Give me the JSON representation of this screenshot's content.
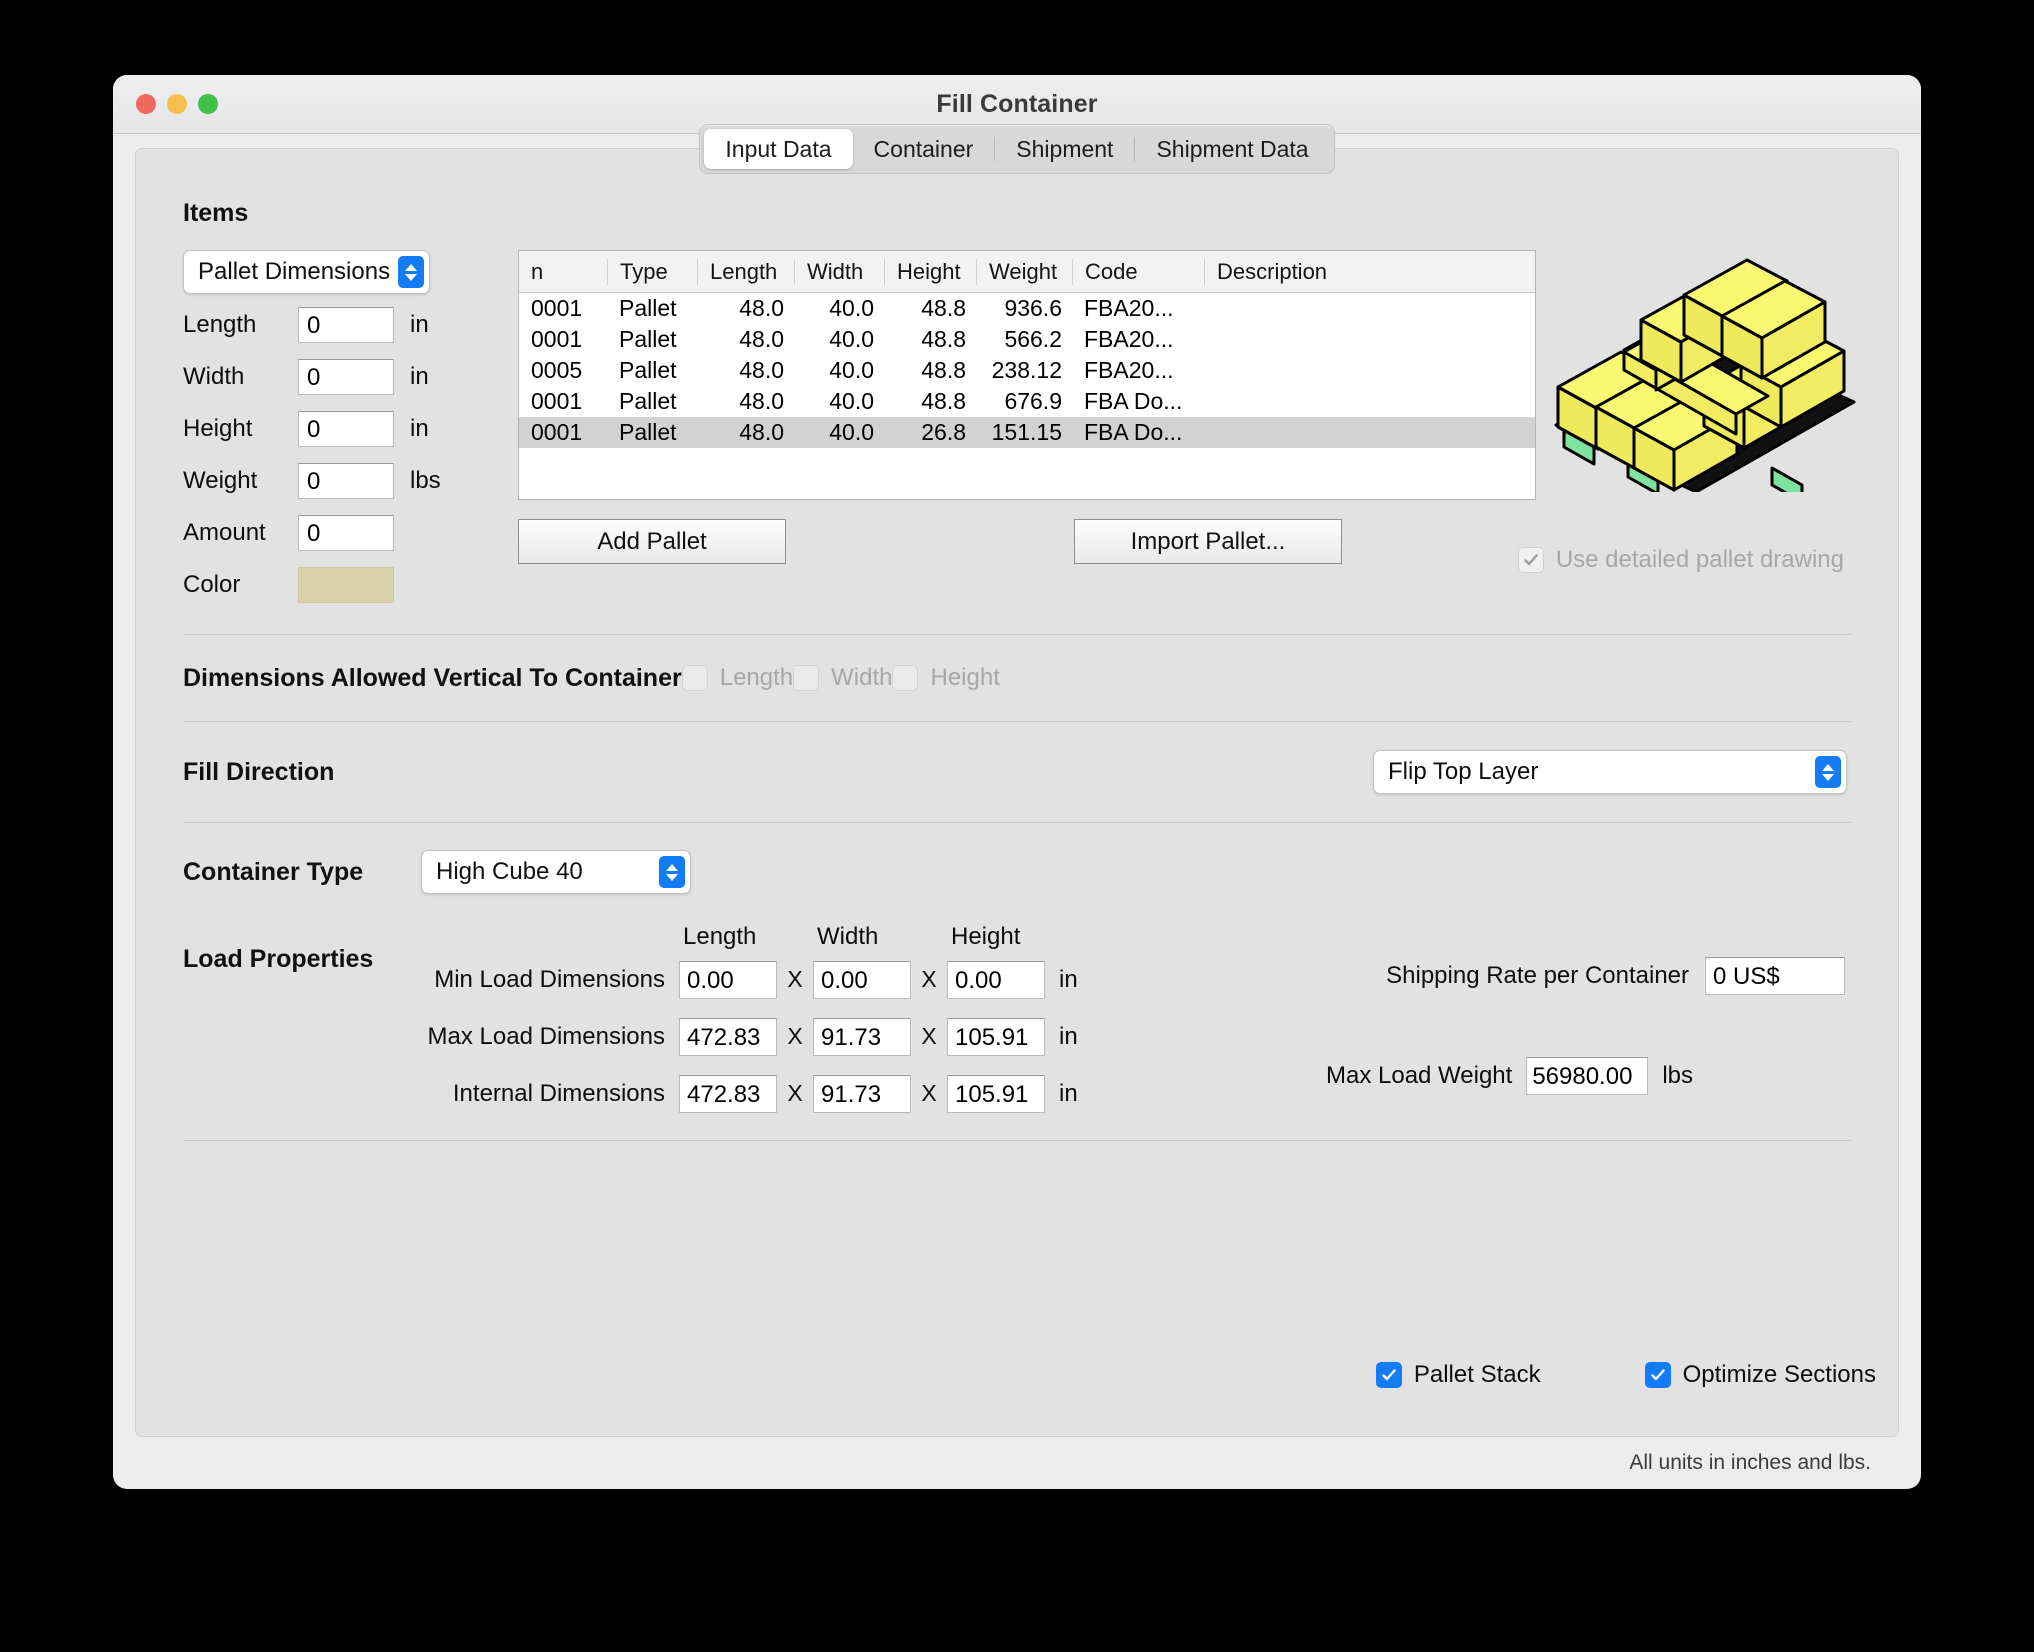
{
  "window": {
    "title": "Fill Container",
    "traffic_lights": [
      "close-red",
      "minimize-yellow",
      "zoom-green"
    ]
  },
  "tabs": [
    {
      "label": "Input Data",
      "selected": true
    },
    {
      "label": "Container",
      "selected": false
    },
    {
      "label": "Shipment",
      "selected": false
    },
    {
      "label": "Shipment Data",
      "selected": false
    }
  ],
  "items": {
    "section_title": "Items",
    "kind_popup": {
      "value": "Pallet Dimensions"
    },
    "fields": [
      {
        "label": "Length",
        "value": "0",
        "unit": "in"
      },
      {
        "label": "Width",
        "value": "0",
        "unit": "in"
      },
      {
        "label": "Height",
        "value": "0",
        "unit": "in"
      },
      {
        "label": "Weight",
        "value": "0",
        "unit": "lbs"
      },
      {
        "label": "Amount",
        "value": "0",
        "unit": ""
      }
    ],
    "color_label": "Color",
    "color_value": "#d9d2a8",
    "buttons": {
      "add": "Add Pallet",
      "import": "Import Pallet..."
    },
    "detailed_drawing": {
      "label": "Use detailed pallet drawing",
      "checked": true,
      "disabled": true
    },
    "table": {
      "columns": [
        "n",
        "Type",
        "Length",
        "Width",
        "Height",
        "Weight",
        "Code",
        "Description"
      ],
      "rows": [
        {
          "n": "0001",
          "type": "Pallet",
          "length": "48.0",
          "width": "40.0",
          "height": "48.8",
          "weight": "936.6",
          "code": "FBA20...",
          "description": "",
          "selected": false
        },
        {
          "n": "0001",
          "type": "Pallet",
          "length": "48.0",
          "width": "40.0",
          "height": "48.8",
          "weight": "566.2",
          "code": "FBA20...",
          "description": "",
          "selected": false
        },
        {
          "n": "0005",
          "type": "Pallet",
          "length": "48.0",
          "width": "40.0",
          "height": "48.8",
          "weight": "238.12",
          "code": "FBA20...",
          "description": "",
          "selected": false
        },
        {
          "n": "0001",
          "type": "Pallet",
          "length": "48.0",
          "width": "40.0",
          "height": "48.8",
          "weight": "676.9",
          "code": "FBA Do...",
          "description": "",
          "selected": false
        },
        {
          "n": "0001",
          "type": "Pallet",
          "length": "48.0",
          "width": "40.0",
          "height": "26.8",
          "weight": "151.15",
          "code": "FBA Do...",
          "description": "",
          "selected": true
        }
      ]
    }
  },
  "dimensions_allowed": {
    "title": "Dimensions Allowed Vertical To Container",
    "options": [
      {
        "label": "Length",
        "checked": false,
        "disabled": true
      },
      {
        "label": "Width",
        "checked": false,
        "disabled": true
      },
      {
        "label": "Height",
        "checked": false,
        "disabled": true
      }
    ]
  },
  "fill_direction": {
    "title": "Fill Direction",
    "value": "Flip Top Layer"
  },
  "container_type": {
    "title": "Container Type",
    "value": "High Cube 40"
  },
  "load_properties": {
    "title": "Load Properties",
    "column_headers": [
      "Length",
      "Width",
      "Height"
    ],
    "x_separator": "X",
    "unit": "in",
    "rows": [
      {
        "label": "Min Load Dimensions",
        "length": "0.00",
        "width": "0.00",
        "height": "0.00"
      },
      {
        "label": "Max Load Dimensions",
        "length": "472.83",
        "width": "91.73",
        "height": "105.91"
      },
      {
        "label": "Internal Dimensions",
        "length": "472.83",
        "width": "91.73",
        "height": "105.91"
      }
    ],
    "shipping_rate": {
      "label": "Shipping Rate per Container",
      "value": "0 US$"
    },
    "max_load_weight": {
      "label": "Max Load Weight",
      "value": "56980.00",
      "unit": "lbs"
    }
  },
  "bottom_options": [
    {
      "label": "Pallet Stack",
      "checked": true
    },
    {
      "label": "Optimize Sections",
      "checked": true
    }
  ],
  "footer": {
    "note": "All units in inches and lbs."
  },
  "colors": {
    "accent": "#147cf6",
    "pallet_box": "#f9f871",
    "pallet_box_side": "#ece95e",
    "pallet_base": "#7fe3a0",
    "window_bg": "#ececec",
    "panel_bg": "#e2e2e2"
  }
}
